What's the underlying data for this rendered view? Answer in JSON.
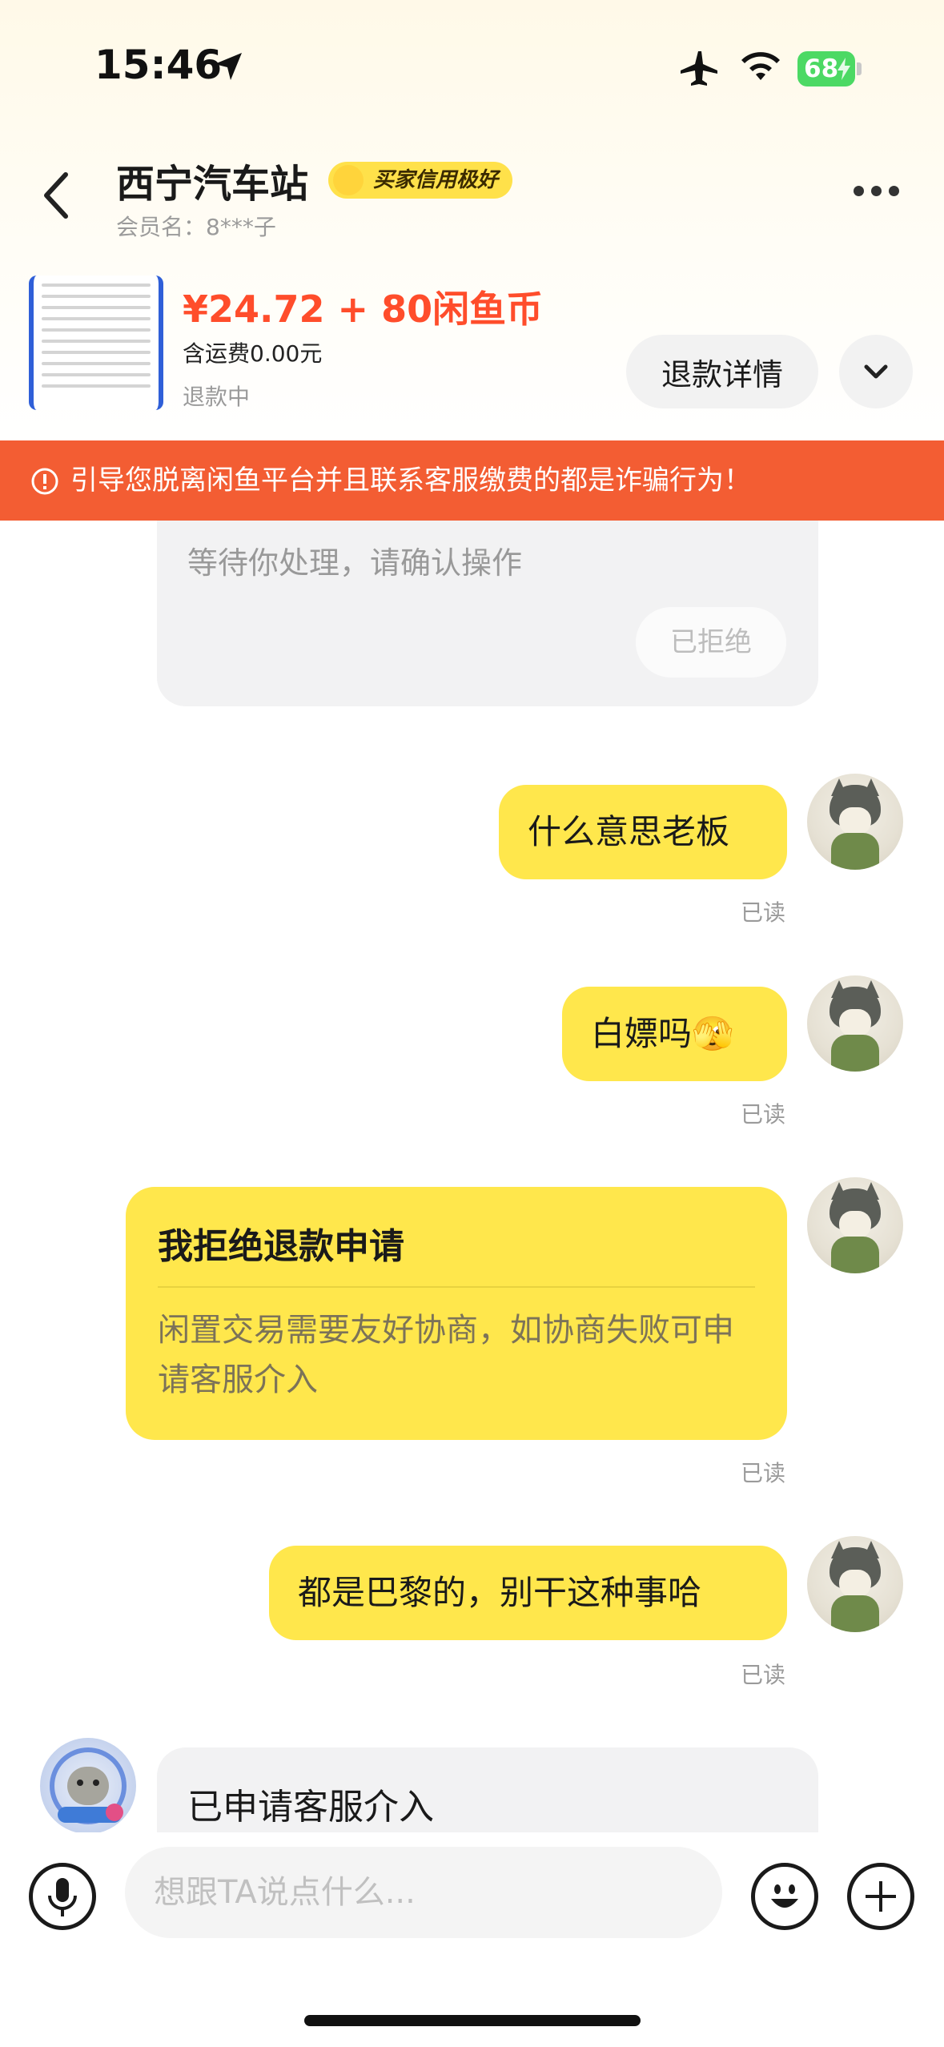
{
  "status_bar": {
    "time": "15:46",
    "battery": "68",
    "icons": [
      "location-arrow-icon",
      "airplane-icon",
      "wifi-icon",
      "battery-icon"
    ]
  },
  "header": {
    "title": "西宁汽车站",
    "badge": "买家信用极好",
    "member": "会员名：8***子",
    "icons": [
      "back-arrow-icon",
      "more-dots-icon"
    ]
  },
  "product": {
    "price": "¥24.72 + 80闲鱼币",
    "shipping": "含运费0.00元",
    "status": "退款中",
    "refund_details_button": "退款详情"
  },
  "warning": {
    "text": "引导您脱离闲鱼平台并且联系客服缴费的都是诈骗行为！",
    "color": "#f35d33"
  },
  "messages": {
    "pending_text": "等待你处理，请确认操作",
    "refused_label": "已拒绝",
    "msg1": "什么意思老板",
    "msg2": "白嫖吗🫣",
    "reject_title": "我拒绝退款申请",
    "reject_desc": "闲置交易需要友好协商，如协商失败可申请客服介入",
    "msg3": "都是巴黎的，别干这种事哈",
    "read": "已读",
    "system_card": "已申请客服介入"
  },
  "input": {
    "placeholder": "想跟TA说点什么..."
  },
  "colors": {
    "bubble": "#ffe74c",
    "price": "#ff4d2b",
    "warning_banner": "#f35d33",
    "battery": "#4cd964"
  }
}
